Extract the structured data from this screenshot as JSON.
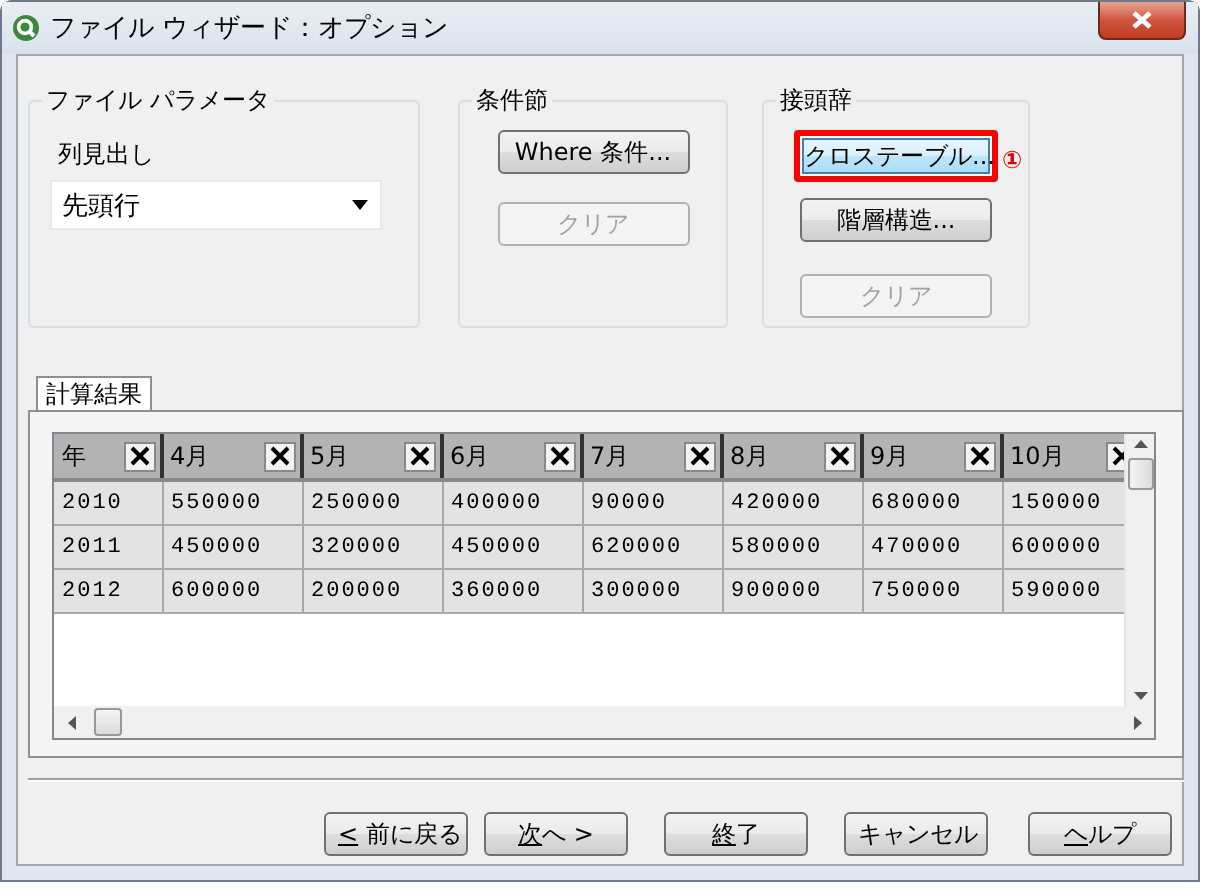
{
  "window": {
    "title": "ファイル ウィザード：オプション"
  },
  "file_parameters": {
    "title": "ファイル パラメータ",
    "header_label": "列見出し",
    "header_dropdown": {
      "value": "先頭行"
    }
  },
  "condition_clause": {
    "title": "条件節",
    "buttons": [
      {
        "label": "Where 条件...",
        "disabled": false,
        "highlighted": false
      },
      {
        "label": "クリア",
        "disabled": true,
        "highlighted": false
      }
    ]
  },
  "prefix": {
    "title": "接頭辞",
    "annotation": "①",
    "buttons": [
      {
        "label": "クロステーブル...",
        "disabled": false,
        "highlighted": true
      },
      {
        "label": "階層構造...",
        "disabled": false,
        "highlighted": false
      },
      {
        "label": "クリア",
        "disabled": true,
        "highlighted": false
      }
    ]
  },
  "tabs": [
    {
      "label": "計算結果",
      "selected": true
    }
  ],
  "table": {
    "columns": [
      "年",
      "4月",
      "5月",
      "6月",
      "7月",
      "8月",
      "9月",
      "10月"
    ],
    "rows": [
      [
        "2010",
        "550000",
        "250000",
        "400000",
        "90000",
        "420000",
        "680000",
        "150000"
      ],
      [
        "2011",
        "450000",
        "320000",
        "450000",
        "620000",
        "580000",
        "470000",
        "600000"
      ],
      [
        "2012",
        "600000",
        "200000",
        "360000",
        "300000",
        "900000",
        "750000",
        "590000"
      ]
    ]
  },
  "footer_buttons": [
    {
      "key": "<",
      "after": " 前に戻る"
    },
    {
      "key": "次",
      "after": "へ >"
    },
    {
      "key": "終",
      "after": "了"
    },
    {
      "before": "キャンセル"
    },
    {
      "key": "ヘ",
      "after": "ルプ"
    }
  ]
}
